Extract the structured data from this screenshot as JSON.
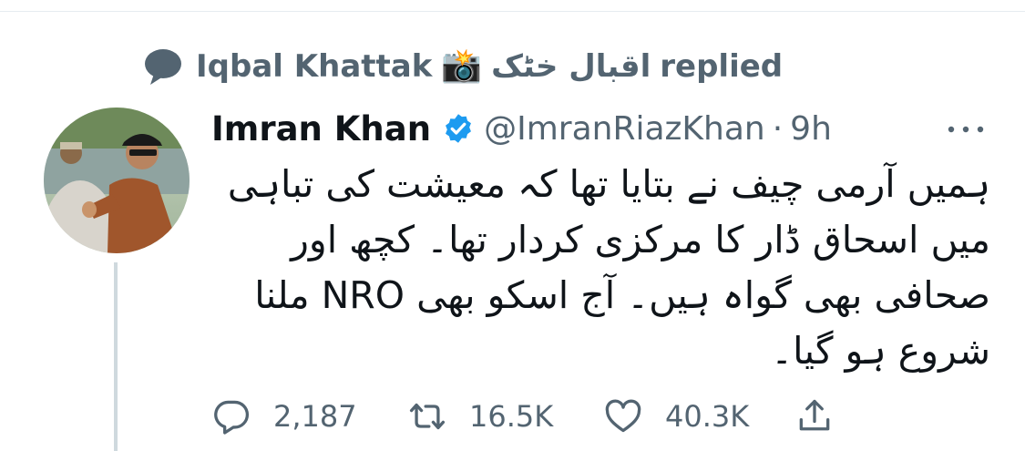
{
  "social_context": {
    "replier_name": "Iqbal Khattak",
    "camera_emoji": "📸",
    "replier_name_urdu": "اقبال خٹک",
    "replied_label": "replied"
  },
  "tweet": {
    "author_name": "Imran Khan",
    "handle": "@ImranRiazKhan",
    "separator": "·",
    "time": "9h",
    "verified": true,
    "text_lines": [
      "ہمیں آرمی چیف نے بتایا تھا کہ معیشت کی تباہی",
      "میں اسحاق ڈار کا مرکزی کردار تھا۔ کچھ اور",
      "صحافی بھی گواہ ہیں۔ آج اسکو بھی NRO ملنا",
      "شروع ہو گیا۔"
    ],
    "stats": {
      "replies": "2,187",
      "retweets": "16.5K",
      "likes": "40.3K"
    }
  },
  "colors": {
    "secondary_text": "#536471",
    "verified_blue": "#1d9bf0",
    "divider": "#e6ecf0",
    "thread_line": "#cfd9de"
  },
  "icons": {
    "social_context": "speech-bubble-icon",
    "verified": "verified-badge-icon",
    "more": "more-dots-icon",
    "reply": "reply-icon",
    "retweet": "retweet-icon",
    "like": "heart-icon",
    "share": "share-icon"
  }
}
